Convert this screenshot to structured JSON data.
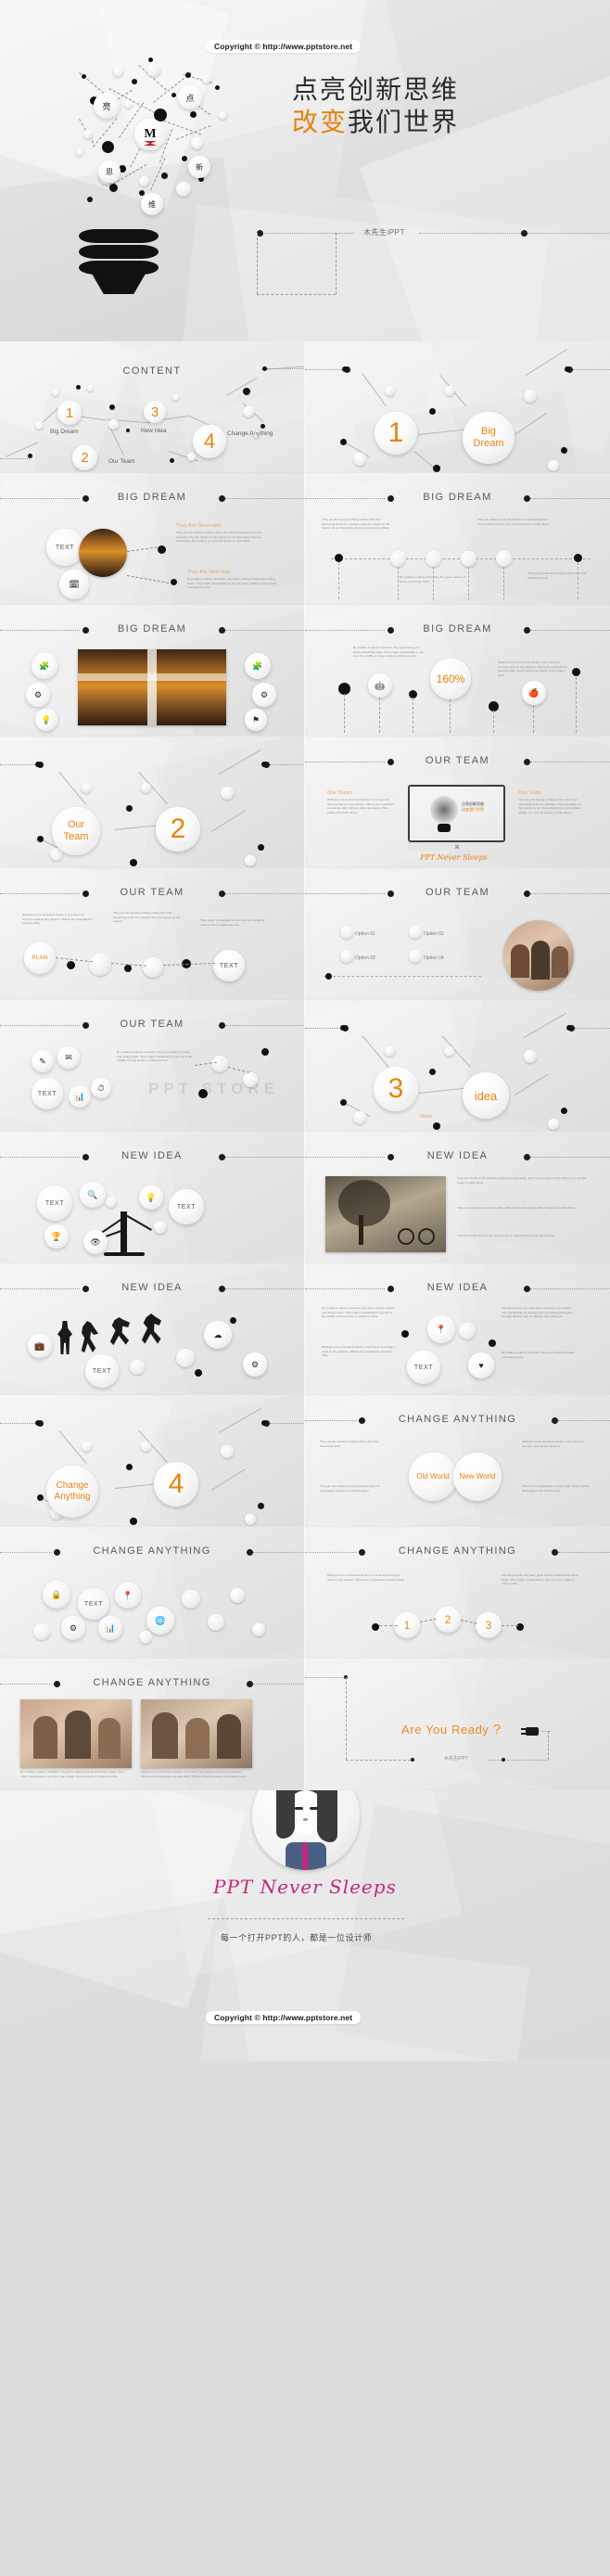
{
  "meta": {
    "copyright_top": "Copyright © http://www.pptstore.net",
    "copyright_bottom": "Copyright © http://www.pptstore.net",
    "accent_color": "#e8820c",
    "brand_pink": "#c2287e",
    "bg_color": "#e6e6e6"
  },
  "hero": {
    "title_line1": "点亮创新思维",
    "title_line2_accent": "改变",
    "title_line2_rest": "我们世界",
    "subtitle": "木先生iPPT",
    "bulb_nodes": [
      "亮",
      "点",
      "M",
      "思",
      "新",
      "维"
    ]
  },
  "slides": [
    {
      "id": "content",
      "title": "CONTENT",
      "items": [
        {
          "num": "1",
          "label": "Big Dream"
        },
        {
          "num": "2",
          "label": "Our Team"
        },
        {
          "num": "3",
          "label": "New Idea"
        },
        {
          "num": "4",
          "label": "Change Anything"
        }
      ]
    },
    {
      "id": "section-1",
      "title": "",
      "big_number": "1",
      "big_label_l1": "Big",
      "big_label_l2": "Dream"
    },
    {
      "id": "big-dream-1",
      "title": "BIG DREAM",
      "text_circle": "TEXT",
      "blocks": [
        {
          "heading": "They Are Observant",
          "body": "They see the beauty in things others don't find interesting at all. For example, they are always on the lookout for an interesting photo to accompany their writing, or a new life lesson to write about."
        },
        {
          "heading": "They Are Well-read",
          "body": "By reading a variety of authors, they get a variety of ideas and writing styles. They might, inexplicably to you, be in the middle of many books or articles at once."
        }
      ]
    },
    {
      "id": "big-dream-2",
      "title": "BIG DREAM",
      "blocks": [
        {
          "heading": "",
          "body": "They see the beauty in things others don't find interesting at all. For example, they are always on the lookout for an interesting photo to accompany writing."
        },
        {
          "heading": "",
          "body": "They are always on the lookout for an interesting photo to accompany writing, or a new life lesson to write about."
        },
        {
          "heading": "",
          "body": "By reading a variety of authors, they get a variety of ideas and writing styles."
        },
        {
          "heading": "",
          "body": "They see the beauty in things others don't find interesting at all."
        }
      ],
      "timeline_nodes": 4
    },
    {
      "id": "big-dream-3",
      "title": "BIG DREAM",
      "icons": [
        "puzzle-icon",
        "gear-icon",
        "bulb-icon",
        "puzzle-icon",
        "gear-icon",
        "flag-icon"
      ],
      "image": "architecture-photo"
    },
    {
      "id": "big-dream-4",
      "title": "BIG DREAM",
      "stat": "160%",
      "icons": [
        "android-icon",
        "apple-icon"
      ],
      "blocks": [
        {
          "body": "By reading a variety of authors, they get a variety of ideas and writing styles. They might, inexplicably to you, be in the middle of many books or articles at once."
        },
        {
          "body": "Writing is not a conscious choice. It is a need, as strong a need as any passion. Others are compelled to exercise daily. Writers share the beauty of the written word."
        }
      ]
    },
    {
      "id": "section-2",
      "title": "",
      "big_number": "2",
      "big_label_l1": "Our",
      "big_label_l2": "Team"
    },
    {
      "id": "our-team-1",
      "title": "OUR TEAM",
      "screen_title_l1": "点亮创新思维",
      "screen_title_l2": "改变我们世界",
      "caption": "PPT Never Sleeps",
      "blocks": [
        {
          "heading": "One Dream",
          "body": "Writing is not a conscious choice. It is a need, as strong a need as any passion. Others are compelled to exercise daily. Writers share the beauty of the written word with others."
        },
        {
          "heading": "One Team",
          "body": "They see the beauty in things others don't find interesting at all. For example, they are always on the lookout for an interesting photo to accompany writing, or a new life lesson to write about."
        }
      ]
    },
    {
      "id": "our-team-2",
      "title": "OUR TEAM",
      "text_circles": [
        "PLAN",
        "TEXT"
      ],
      "blocks": [
        {
          "body": "Writing is not a conscious choice. It is a need, as strong a need as any passion. Others are compelled to exercise daily."
        },
        {
          "body": "They see the beauty in things others don't find interesting at all. For example they are always on the lookout."
        },
        {
          "body": "They might, inexplicably to you, be in the middle of many books or articles at once."
        }
      ]
    },
    {
      "id": "our-team-3",
      "title": "OUR TEAM",
      "legend": [
        "Option 01",
        "Option 02",
        "Option 03",
        "Option 04"
      ],
      "image": "team-photo"
    },
    {
      "id": "our-team-4",
      "title": "OUR TEAM",
      "text_circle": "TEXT",
      "watermark": "PPT STORE",
      "icons": [
        "pen-icon",
        "mail-icon",
        "chart-icon",
        "clock-icon"
      ],
      "blocks": [
        {
          "body": "By reading a variety of authors, they get a variety of ideas and writing styles. They might, inexplicably to you, be in the middle of many books or articles at once."
        }
      ]
    },
    {
      "id": "section-3",
      "title": "",
      "big_number": "3",
      "big_label": "idea",
      "sub_label": "New"
    },
    {
      "id": "new-idea-1",
      "title": "NEW IDEA",
      "text_circle": "TEXT",
      "icons": [
        "search-icon",
        "trophy-icon",
        "eye-icon",
        "bulb-icon"
      ]
    },
    {
      "id": "new-idea-2",
      "title": "NEW IDEA",
      "image": "bicycle-tree-photo",
      "blocks": [
        {
          "body": "They see beauty in the balance of an interesting article, and it is so unique it feels willing, or a new life lesson to write about."
        },
        {
          "body": "They are compelled to exercise daily. Writers share the beauty of the written word with others."
        },
        {
          "body": "The best writers learn to use rejection as an opportunity to grow and develop."
        }
      ]
    },
    {
      "id": "new-idea-3",
      "title": "NEW IDEA",
      "text_circle": "TEXT",
      "icons": [
        "briefcase-icon",
        "person-icon",
        "runner-icon",
        "jump-icon",
        "cloud-icon",
        "gear-icon"
      ]
    },
    {
      "id": "new-idea-4",
      "title": "NEW IDEA",
      "text_circle": "TEXT",
      "icons": [
        "pin-icon",
        "heart-icon"
      ],
      "blocks": [
        {
          "body": "By reading a variety of authors, they get a variety of ideas and writing styles. They might, inexplicably to you, be in the middle of many books or articles at once."
        },
        {
          "body": "Writing is not a conscious choice. It is a need, as strong a need as any passion. Others are compelled to exercise daily."
        },
        {
          "body": "Five-step course you have been working on something new. Something you already love something that makes the idea special, look for where it has made you."
        },
        {
          "body": "By reading a variety of authors, they get a variety of ideas and writing styles."
        }
      ]
    },
    {
      "id": "section-4",
      "title": "",
      "big_number": "4",
      "big_label_l1": "Change",
      "big_label_l2": "Anything"
    },
    {
      "id": "change-1",
      "title": "CHANGE ANYTHING",
      "circles": [
        "Old World",
        "New World"
      ],
      "blocks": [
        {
          "body": "They see the beauty in things others don't find interesting at all."
        },
        {
          "body": "They are the lookout for an interesting photo to accompany writing or a new life lesson."
        },
        {
          "body": "Writing is not a conscious choice. It is a need, as strong a need as any passion."
        },
        {
          "body": "Others are compelled to exercise daily. Writers share the beauty of the written word."
        }
      ]
    },
    {
      "id": "change-2",
      "title": "CHANGE ANYTHING",
      "text_circle": "TEXT",
      "icons": [
        "lock-icon",
        "pin-icon",
        "gear-icon",
        "chart-icon",
        "globe-icon"
      ]
    },
    {
      "id": "change-3",
      "title": "CHANGE ANYTHING",
      "numbers": [
        "1",
        "2",
        "3"
      ],
      "blocks": [
        {
          "body": "Writing is not a conscious choice. It is a need, as strong a need as any passion. Others are compelled to exercise daily."
        },
        {
          "body": "Five-step course only idea, gives variety of ideas and writing styles. They might, inexplicably to you, be in the middle of many books."
        }
      ]
    },
    {
      "id": "change-4",
      "title": "CHANGE ANYTHING",
      "images": [
        "shopping-photo-1",
        "shopping-photo-2"
      ],
      "blocks": [
        {
          "body": "By reading a variety of authors, they get a variety of ideas and writing styles. They might, inexplicably to you, be in the middle of many books or articles at once."
        },
        {
          "body": "Writing is not a conscious choice. It is a need, as strong a need as any passion. Others are compelled to exercise daily. Writers share the beauty of the written word."
        }
      ]
    },
    {
      "id": "are-you-ready",
      "title": "",
      "headline": "Are You Ready",
      "headline_mark": "?",
      "footer": "木先生iPPT",
      "icon": "plug-icon"
    }
  ],
  "ending": {
    "title": "PPT Never Sleeps",
    "subtitle": "每一个打开PPT的人，都是一位设计师",
    "avatar": "girl-avatar"
  }
}
